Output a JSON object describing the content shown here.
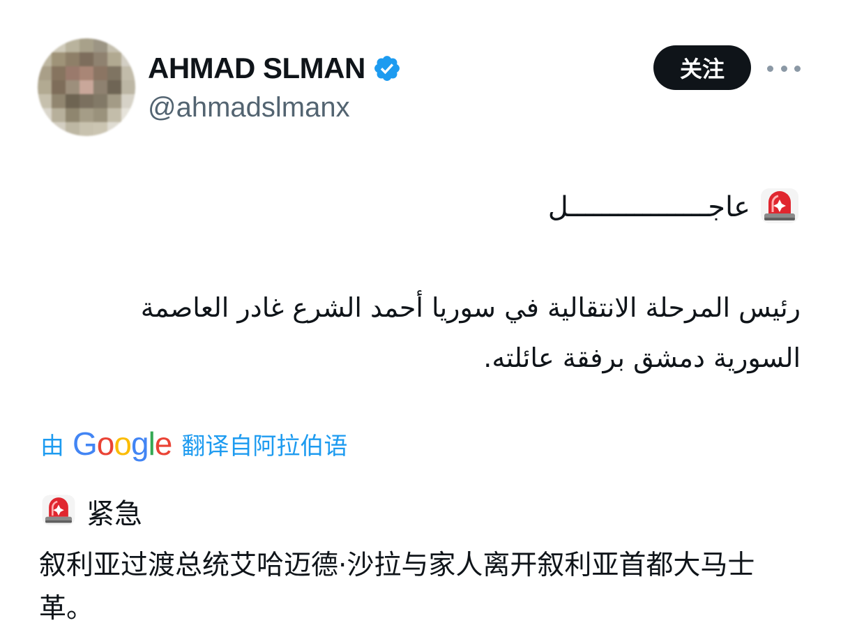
{
  "author": {
    "display_name": "AHMAD SLMAN",
    "handle": "@ahmadslmanx",
    "verified": true
  },
  "actions": {
    "follow_label": "关注",
    "more_icon": "more-horizontal-icon"
  },
  "tweet": {
    "urgent_label_ar": "عاجـــــــــــــــــل",
    "body_ar": "رئيس المرحلة الانتقالية في سوريا أحمد الشرع غادر العاصمة السورية دمشق برفقة عائلته.",
    "siren_icon": "police-car-light-icon"
  },
  "translation": {
    "prefix": "由",
    "provider": "Google",
    "suffix": "翻译自阿拉伯语",
    "urgent_label_zh": "紧急",
    "body_zh": "叙利亚过渡总统艾哈迈德·沙拉与家人离开叙利亚首都大马士革。"
  },
  "colors": {
    "link_blue": "#1d9bf0",
    "verified_blue": "#1d9bf0",
    "button_black": "#0f1419",
    "secondary_text": "#536471",
    "siren_red": "#e0262f"
  }
}
